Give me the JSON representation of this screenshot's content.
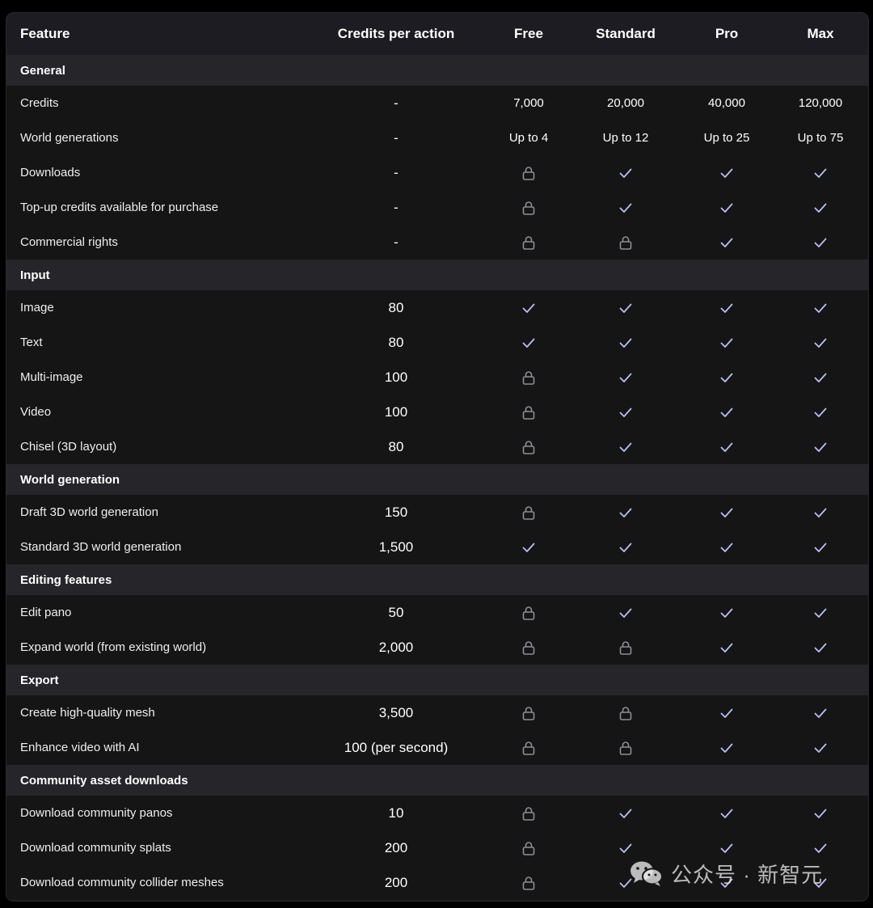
{
  "header": {
    "feature": "Feature",
    "credits": "Credits per action",
    "plans": [
      "Free",
      "Standard",
      "Pro",
      "Max"
    ]
  },
  "sections": [
    {
      "title": "General",
      "rows": [
        {
          "feature": "Credits",
          "credits": "-",
          "plans": [
            "7,000",
            "20,000",
            "40,000",
            "120,000"
          ]
        },
        {
          "feature": "World generations",
          "credits": "-",
          "plans": [
            "Up to 4",
            "Up to 12",
            "Up to 25",
            "Up to 75"
          ]
        },
        {
          "feature": "Downloads",
          "credits": "-",
          "plans": [
            "lock",
            "check",
            "check",
            "check"
          ]
        },
        {
          "feature": "Top-up credits available for purchase",
          "credits": "-",
          "plans": [
            "lock",
            "check",
            "check",
            "check"
          ]
        },
        {
          "feature": "Commercial rights",
          "credits": "-",
          "plans": [
            "lock",
            "lock",
            "check",
            "check"
          ]
        }
      ]
    },
    {
      "title": "Input",
      "rows": [
        {
          "feature": "Image",
          "credits": "80",
          "plans": [
            "check",
            "check",
            "check",
            "check"
          ]
        },
        {
          "feature": "Text",
          "credits": "80",
          "plans": [
            "check",
            "check",
            "check",
            "check"
          ]
        },
        {
          "feature": "Multi-image",
          "credits": "100",
          "plans": [
            "lock",
            "check",
            "check",
            "check"
          ]
        },
        {
          "feature": "Video",
          "credits": "100",
          "plans": [
            "lock",
            "check",
            "check",
            "check"
          ]
        },
        {
          "feature": "Chisel (3D layout)",
          "credits": "80",
          "plans": [
            "lock",
            "check",
            "check",
            "check"
          ]
        }
      ]
    },
    {
      "title": "World generation",
      "rows": [
        {
          "feature": "Draft 3D world generation",
          "credits": "150",
          "plans": [
            "lock",
            "check",
            "check",
            "check"
          ]
        },
        {
          "feature": "Standard 3D world generation",
          "credits": "1,500",
          "plans": [
            "check",
            "check",
            "check",
            "check"
          ]
        }
      ]
    },
    {
      "title": "Editing features",
      "rows": [
        {
          "feature": "Edit pano",
          "credits": "50",
          "plans": [
            "lock",
            "check",
            "check",
            "check"
          ]
        },
        {
          "feature": "Expand world (from existing world)",
          "credits": "2,000",
          "plans": [
            "lock",
            "lock",
            "check",
            "check"
          ]
        }
      ]
    },
    {
      "title": "Export",
      "rows": [
        {
          "feature": "Create high-quality mesh",
          "credits": "3,500",
          "plans": [
            "lock",
            "lock",
            "check",
            "check"
          ]
        },
        {
          "feature": "Enhance video with AI",
          "credits": "100 (per second)",
          "plans": [
            "lock",
            "lock",
            "check",
            "check"
          ]
        }
      ]
    },
    {
      "title": "Community asset downloads",
      "rows": [
        {
          "feature": "Download community panos",
          "credits": "10",
          "plans": [
            "lock",
            "check",
            "check",
            "check"
          ]
        },
        {
          "feature": "Download community splats",
          "credits": "200",
          "plans": [
            "lock",
            "check",
            "check",
            "check"
          ]
        },
        {
          "feature": "Download community collider meshes",
          "credits": "200",
          "plans": [
            "lock",
            "check",
            "check",
            "check"
          ]
        }
      ]
    }
  ],
  "watermark": {
    "text": "公众号 · 新智元",
    "icon": "wechat-icon"
  },
  "colors": {
    "check": "#b9bff5",
    "lock": "#8e8e94",
    "section_bg": "#25252a",
    "row_bg": "#151515"
  }
}
